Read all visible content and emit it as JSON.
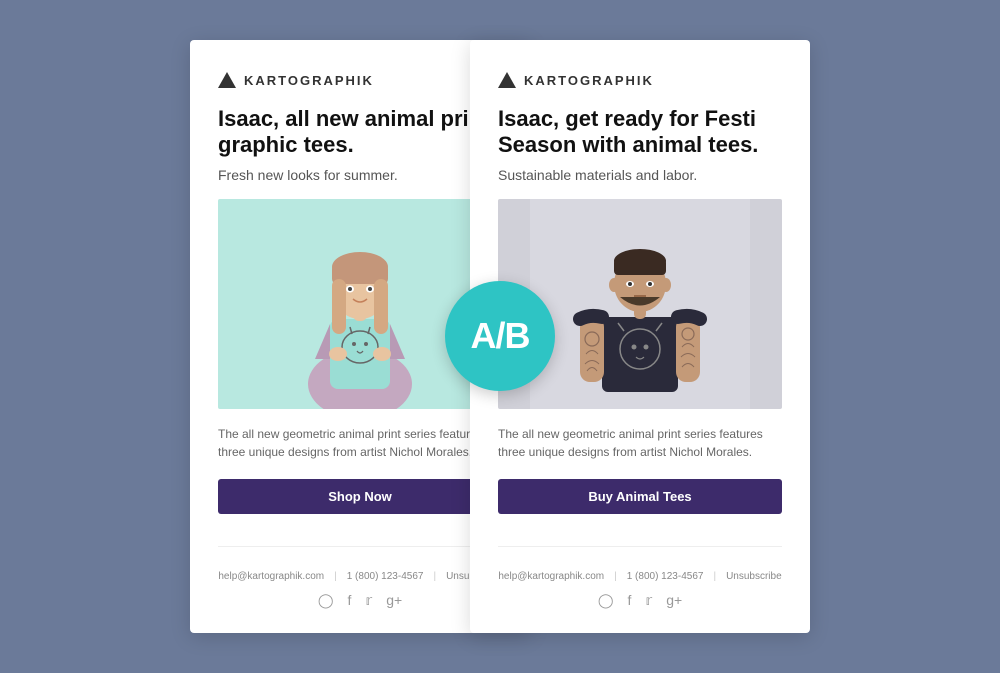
{
  "brand": {
    "name": "KARTOGRAPHIK",
    "logo_alt": "Triangle logo"
  },
  "ab_badge": {
    "label": "A/B"
  },
  "card_a": {
    "headline": "Isaac, all new animal print graphic tees.",
    "subheadline": "Fresh new looks for summer.",
    "description": "The all new geometric animal print series features three unique designs from artist Nichol Morales.",
    "cta_label": "Shop Now",
    "image_alt": "Woman wearing animal print tee",
    "footer": {
      "email": "help@kartographik.com",
      "phone": "1 (800) 123-4567",
      "unsubscribe": "Unsubscribe"
    },
    "social": [
      "instagram",
      "facebook",
      "twitter",
      "google-plus"
    ]
  },
  "card_b": {
    "headline": "Isaac, get ready for Festi Season with animal tees.",
    "subheadline": "Sustainable materials and labor.",
    "description": "The all new geometric animal print series features three unique designs from artist Nichol Morales.",
    "cta_label": "Buy Animal Tees",
    "image_alt": "Man wearing animal print tee",
    "footer": {
      "email": "help@kartographik.com",
      "phone": "1 (800) 123-4567",
      "unsubscribe": "Unsubscribe"
    },
    "social": [
      "instagram",
      "facebook",
      "twitter",
      "google-plus"
    ]
  },
  "colors": {
    "background": "#6b7a99",
    "card": "#ffffff",
    "cta": "#3d2b6b",
    "badge": "#2ec4c4",
    "image_a_bg": "#b8e8e0",
    "image_b_bg": "#d0d0d8"
  }
}
